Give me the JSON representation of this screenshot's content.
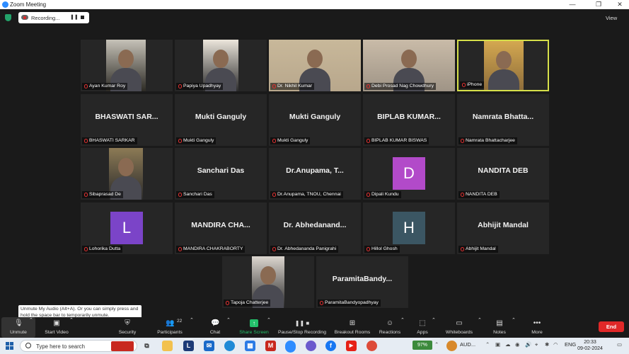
{
  "window": {
    "title": "Zoom Meeting",
    "minimize": "—",
    "maximize": "❐",
    "close": "✕"
  },
  "recording": {
    "label": "Recording...",
    "pause_glyph": "❚❚"
  },
  "view_button": {
    "label": "View"
  },
  "tiles": [
    {
      "name": "Ayan Kumar Roy",
      "big": "",
      "type": "video"
    },
    {
      "name": "Papiya Upadhyay",
      "big": "",
      "type": "video"
    },
    {
      "name": "Dr. Nikhil Kumar",
      "big": "",
      "type": "video"
    },
    {
      "name": "Debi Prosad Nag Chowdhury",
      "big": "",
      "type": "video"
    },
    {
      "name": "iPhone",
      "big": "",
      "type": "video",
      "active": true
    },
    {
      "name": "BHASWATI SARKAR",
      "big": "BHASWATI  SAR...",
      "type": "text"
    },
    {
      "name": "Mukti Ganguly",
      "big": "Mukti Ganguly",
      "type": "text"
    },
    {
      "name": "Mukti Ganguly",
      "big": "Mukti Ganguly",
      "type": "text"
    },
    {
      "name": "BIPLAB KUMAR BISWAS",
      "big": "BIPLAB  KUMAR...",
      "type": "text"
    },
    {
      "name": "Namrata Bhattacharjee",
      "big": "Namrata  Bhatta...",
      "type": "text"
    },
    {
      "name": "Sibaprasad De",
      "big": "",
      "type": "video"
    },
    {
      "name": "Sanchari Das",
      "big": "Sanchari Das",
      "type": "text"
    },
    {
      "name": "Dr.Anupama, TNOU, Chennai",
      "big": "Dr.Anupama,  T...",
      "type": "text"
    },
    {
      "name": "Dipali Kundu",
      "big": "",
      "type": "avatar",
      "letter": "D",
      "color": "#b24ac9"
    },
    {
      "name": "NANDITA DEB",
      "big": "NANDITA DEB",
      "type": "text"
    },
    {
      "name": "Lohorika Dutta",
      "big": "",
      "type": "avatar",
      "letter": "L",
      "color": "#7b44c8"
    },
    {
      "name": "MANDIRA CHAKRABORTY",
      "big": "MANDIRA  CHA...",
      "type": "text"
    },
    {
      "name": "Dr. Abhedananda Panigrahi",
      "big": "Dr.  Abhedanand...",
      "type": "text"
    },
    {
      "name": "Hillol Ghosh",
      "big": "",
      "type": "avatar",
      "letter": "H",
      "color": "#3b5663"
    },
    {
      "name": "Abhijit Mandal",
      "big": "Abhijit Mandal",
      "type": "text"
    },
    {
      "name": "Tapoja Chatterjee",
      "big": "",
      "type": "video"
    },
    {
      "name": "ParamitaBandyopadhyay",
      "big": "ParamitaBandy...",
      "type": "text"
    }
  ],
  "toolbar": {
    "unmute": "Unmute",
    "start_video": "Start Video",
    "security": "Security",
    "participants": "Participants",
    "participants_count": "22",
    "chat": "Chat",
    "share_screen": "Share Screen",
    "pause_stop_recording": "Pause/Stop Recording",
    "breakout_rooms": "Breakout Rooms",
    "reactions": "Reactions",
    "apps": "Apps",
    "whiteboards": "Whiteboards",
    "notes": "Notes",
    "more": "More",
    "end": "End"
  },
  "tooltip": {
    "text": "Unmute My Audio (Alt+A). Or you can simply press and hold the space bar to temporarily unmute."
  },
  "taskbar": {
    "search_placeholder": "Type here to search",
    "battery": "97%",
    "audio_label": "AUD...",
    "language": "ENG",
    "time": "20:33",
    "date": "09-02-2024"
  },
  "colors": {
    "active_speaker": "#d6e04a",
    "end_button": "#e02828",
    "share_screen": "#23c16b"
  }
}
